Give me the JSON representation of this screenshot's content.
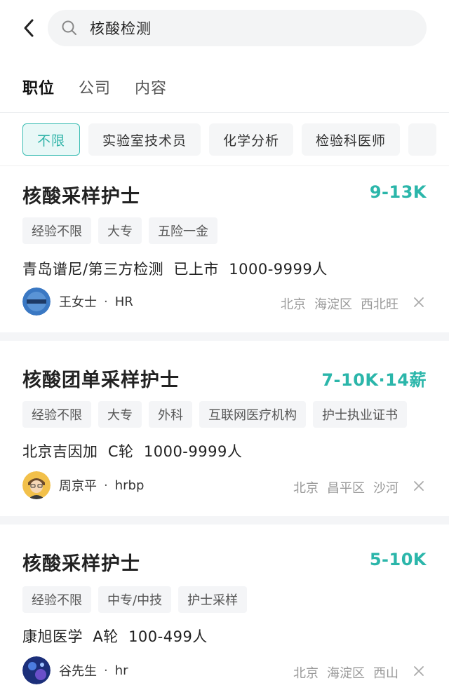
{
  "search": {
    "query": "核酸检测"
  },
  "tabs": [
    {
      "label": "职位",
      "active": true
    },
    {
      "label": "公司",
      "active": false
    },
    {
      "label": "内容",
      "active": false
    }
  ],
  "filters": [
    {
      "label": "不限",
      "active": true
    },
    {
      "label": "实验室技术员",
      "active": false
    },
    {
      "label": "化学分析",
      "active": false
    },
    {
      "label": "检验科医师",
      "active": false
    }
  ],
  "jobs": [
    {
      "title": "核酸采样护士",
      "salary": "9-13K",
      "tags": [
        "经验不限",
        "大专",
        "五险一金"
      ],
      "company": "青岛谱尼/第三方检测  已上市  1000-9999人",
      "recruiter": {
        "name": "王女士",
        "role": "HR"
      },
      "location": [
        "北京",
        "海淀区",
        "西北旺"
      ]
    },
    {
      "title": "核酸团单采样护士",
      "salary": "7-10K·14薪",
      "tags": [
        "经验不限",
        "大专",
        "外科",
        "互联网医疗机构",
        "护士执业证书"
      ],
      "company": "北京吉因加  C轮  1000-9999人",
      "recruiter": {
        "name": "周京平",
        "role": "hrbp"
      },
      "location": [
        "北京",
        "昌平区",
        "沙河"
      ]
    },
    {
      "title": "核酸采样护士",
      "salary": "5-10K",
      "tags": [
        "经验不限",
        "中专/中技",
        "护士采样"
      ],
      "company": "康旭医学  A轮  100-499人",
      "recruiter": {
        "name": "谷先生",
        "role": "hr"
      },
      "location": [
        "北京",
        "海淀区",
        "西山"
      ]
    }
  ],
  "colors": {
    "accent": "#2bb6aa",
    "chip_active_bg": "#e8f8f7",
    "separator": "#f4f5f7"
  },
  "icons": {
    "back": "chevron-left-icon",
    "search": "search-icon",
    "close": "close-icon"
  }
}
